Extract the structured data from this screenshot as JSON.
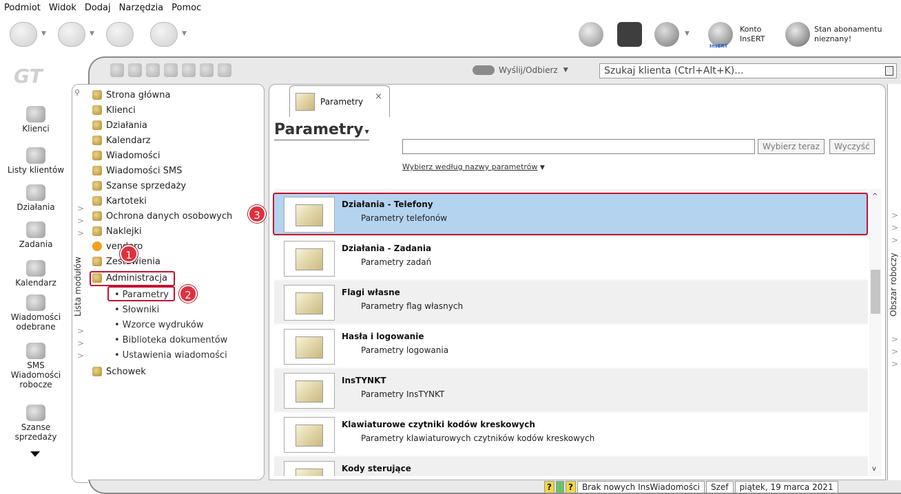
{
  "menu": [
    "Podmiot",
    "Widok",
    "Dodaj",
    "Narzędzia",
    "Pomoc"
  ],
  "account": {
    "line1": "Konto",
    "line2": "InsERT",
    "logo": "InsERT"
  },
  "subscription": {
    "line1": "Stan abonamentu",
    "line2": "nieznany!"
  },
  "logo_text": "GT",
  "send_label": "Wyślij/Odbierz",
  "search_placeholder": "Szukaj klienta (Ctrl+Alt+K)...",
  "leftnav": [
    {
      "label": "Klienci",
      "icon": "clients-icon"
    },
    {
      "label": "Listy klientów",
      "icon": "client-lists-icon"
    },
    {
      "label": "Działania",
      "icon": "actions-icon"
    },
    {
      "label": "Zadania",
      "icon": "tasks-icon"
    },
    {
      "label": "Kalendarz",
      "icon": "calendar-icon"
    },
    {
      "label": "Wiadomości odebrane",
      "icon": "inbox-icon"
    },
    {
      "label": "Wiadomości robocze",
      "icon": "sms-icon",
      "badge": "SMS"
    },
    {
      "label": "Szanse sprzedaży",
      "icon": "sales-chances-icon"
    }
  ],
  "modules_label": "Lista modułów",
  "tree": [
    {
      "label": "Strona główna",
      "icon": "home-icon"
    },
    {
      "label": "Klienci",
      "icon": "clients-icon"
    },
    {
      "label": "Działania",
      "icon": "actions-icon"
    },
    {
      "label": "Kalendarz",
      "icon": "calendar-icon"
    },
    {
      "label": "Wiadomości",
      "icon": "messages-icon"
    },
    {
      "label": "Wiadomości SMS",
      "icon": "sms-icon"
    },
    {
      "label": "Szanse sprzedaży",
      "icon": "sales-icon"
    },
    {
      "label": "Kartoteki",
      "icon": "folders-icon"
    },
    {
      "label": "Ochrona danych osobowych",
      "icon": "privacy-icon"
    },
    {
      "label": "Naklejki",
      "icon": "stickers-icon"
    },
    {
      "label": "vendero",
      "icon": "vendero-icon"
    },
    {
      "label": "Zestawienia",
      "icon": "reports-icon"
    },
    {
      "label": "Administracja",
      "icon": "admin-icon"
    }
  ],
  "tree_sub": [
    "Parametry",
    "Słowniki",
    "Wzorce wydruków",
    "Biblioteka dokumentów",
    "Ustawienia wiadomości"
  ],
  "tree_last": {
    "label": "Schowek",
    "icon": "clipboard-icon"
  },
  "tab": {
    "label": "Parametry",
    "close": "×"
  },
  "page_title": "Parametry",
  "buttons": {
    "select": "Wybierz teraz",
    "clear": "Wyczyść"
  },
  "filter_link": "Wybierz według nazwy parametrów",
  "rows": [
    {
      "title": "Działania - Telefony",
      "sub": "Parametry telefonów"
    },
    {
      "title": "Działania - Zadania",
      "sub": "Parametry zadań"
    },
    {
      "title": "Flagi własne",
      "sub": "Parametry flag własnych"
    },
    {
      "title": "Hasła i logowanie",
      "sub": "Parametry logowania"
    },
    {
      "title": "InsTYNKT",
      "sub": "Parametry InsTYNKT"
    },
    {
      "title": "Klawiaturowe czytniki kodów kreskowych",
      "sub": "Parametry klawiaturowych czytników kodów kreskowych"
    },
    {
      "title": "Kody sterujące",
      "sub": ""
    }
  ],
  "workspace_label": "Obszar roboczy",
  "annotations": [
    "1",
    "2",
    "3"
  ],
  "status": {
    "q1": "?",
    "q2": "?",
    "messages": "Brak nowych InsWiadomości",
    "user": "Szef",
    "date": "piątek, 19 marca 2021"
  },
  "colors": {
    "selected_row": "#b4d3ef",
    "annotation": "#e1303c"
  }
}
